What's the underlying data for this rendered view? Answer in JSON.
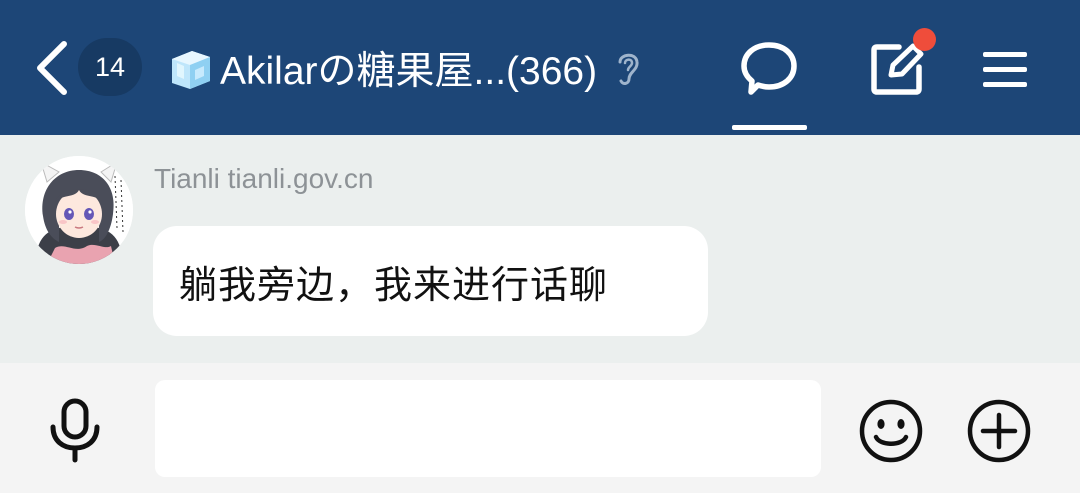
{
  "header": {
    "unread_count": "14",
    "group_title": "Akilarの糖果屋...(366)",
    "icons": {
      "back": "chevron-left-icon",
      "group": "ice-cube-icon",
      "ear": "ear-icon",
      "chat_tab": "chat-bubble-icon",
      "post": "edit-square-icon",
      "menu": "hamburger-menu-icon"
    },
    "colors": {
      "bar": "#1d4677",
      "badge": "#173a63",
      "notify_dot": "#ef4d3b"
    }
  },
  "messages": [
    {
      "sender": "Tianli tianli.gov.cn",
      "text": "躺我旁边，我来进行话聊"
    }
  ],
  "input": {
    "value": "",
    "icons": {
      "voice": "microphone-icon",
      "emoji": "smiley-icon",
      "more": "plus-circle-icon"
    }
  }
}
